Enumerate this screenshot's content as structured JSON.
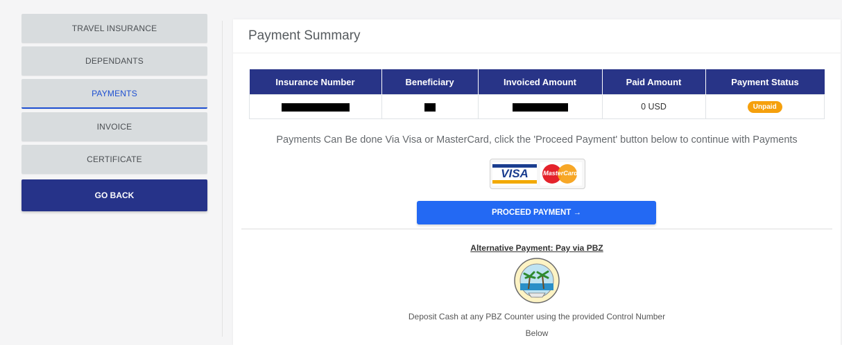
{
  "sidebar": {
    "items": [
      {
        "label": "TRAVEL INSURANCE"
      },
      {
        "label": "DEPENDANTS"
      },
      {
        "label": "PAYMENTS",
        "active": true
      },
      {
        "label": "INVOICE"
      },
      {
        "label": "CERTIFICATE"
      }
    ],
    "back_label": "GO BACK"
  },
  "panel": {
    "title": "Payment Summary",
    "table": {
      "headers": [
        "Insurance Number",
        "Beneficiary",
        "Invoiced Amount",
        "Paid Amount",
        "Payment Status"
      ],
      "row": {
        "insurance_number": "[redacted]",
        "beneficiary": "[redacted]",
        "invoiced_amount": "[redacted]",
        "paid_amount": "0 USD",
        "status": "Unpaid"
      }
    },
    "note": "Payments Can Be done Via Visa or MasterCard, click the 'Proceed Payment' button below to continue with Payments",
    "card_logos": {
      "visa": "VISA",
      "mastercard": "MasterCard"
    },
    "proceed_label": "PROCEED PAYMENT →",
    "alternative_title": "Alternative Payment: Pay via PBZ",
    "pbz_logo": "pbz-seal-icon",
    "deposit_line1": "Deposit Cash at any PBZ Counter using the provided Control Number",
    "deposit_line2": "Below"
  },
  "colors": {
    "nav_bg": "#d8dcde",
    "active_accent": "#1d4fd1",
    "back_button": "#263389",
    "table_header": "#283487",
    "proceed_button": "#2369f3",
    "status_unpaid": "#f5a00d"
  }
}
